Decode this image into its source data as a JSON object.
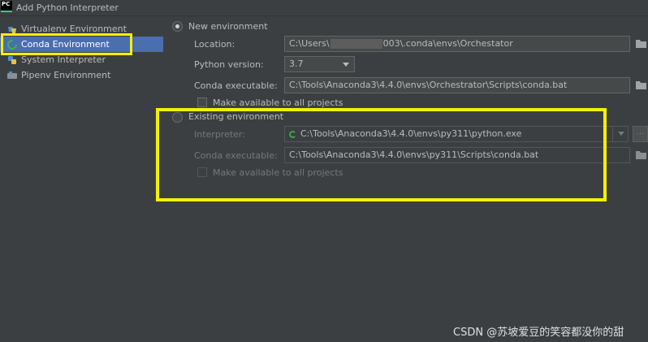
{
  "window": {
    "title": "Add Python Interpreter",
    "app_icon": "PC"
  },
  "sidebar": {
    "items": [
      {
        "label": "Virtualenv Environment",
        "icon": "virtualenv-icon"
      },
      {
        "label": "Conda Environment",
        "icon": "conda-icon",
        "selected": true
      },
      {
        "label": "System Interpreter",
        "icon": "python-icon"
      },
      {
        "label": "Pipenv Environment",
        "icon": "pipenv-icon"
      }
    ]
  },
  "new_env": {
    "radio_label": "New environment",
    "selected": true,
    "location_label": "Location:",
    "location_value_prefix": "C:\\Users\\",
    "location_value_suffix": "003\\.conda\\envs\\Orchestator",
    "python_version_label": "Python version:",
    "python_version_value": "3.7",
    "conda_exec_label": "Conda executable:",
    "conda_exec_value": "C:\\Tools\\Anaconda3\\4.4.0\\envs\\Orchestrator\\Scripts\\conda.bat",
    "make_available_label": "Make available to all projects"
  },
  "existing_env": {
    "radio_label": "Existing environment",
    "selected": false,
    "interpreter_label": "Interpreter:",
    "interpreter_value": "C:\\Tools\\Anaconda3\\4.4.0\\envs\\py311\\python.exe",
    "browse_label": "...",
    "conda_exec_label": "Conda executable:",
    "conda_exec_value": "C:\\Tools\\Anaconda3\\4.4.0\\envs\\py311\\Scripts\\conda.bat",
    "make_available_label": "Make available to all projects"
  },
  "watermark": "CSDN @苏坡爱豆的笑容都没你的甜",
  "colors": {
    "background": "#3c3f41",
    "selection": "#4b6eaf",
    "highlight": "#f5f005",
    "folder": "#a0a4a8"
  }
}
